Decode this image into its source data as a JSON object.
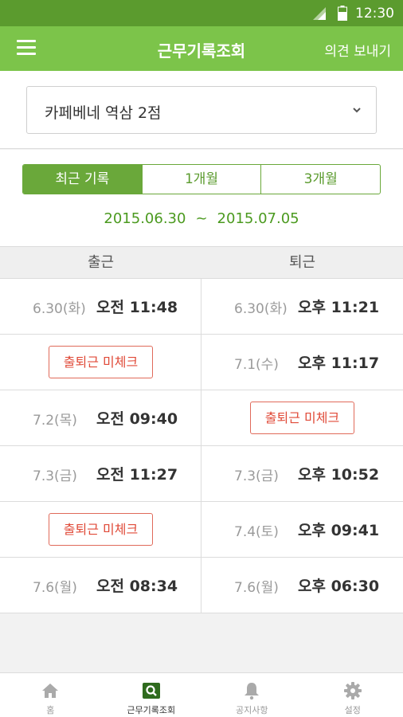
{
  "status_bar": {
    "time": "12:30"
  },
  "header": {
    "title": "근무기록조회",
    "feedback_label": "의견 보내기"
  },
  "store_select": {
    "value": "카페베네 역삼 2점"
  },
  "period_tabs": [
    {
      "label": "최근 기록",
      "active": true
    },
    {
      "label": "1개월",
      "active": false
    },
    {
      "label": "3개월",
      "active": false
    }
  ],
  "date_range": {
    "start": "2015.06.30",
    "separator": "~",
    "end": "2015.07.05"
  },
  "columns": {
    "clock_in": "출근",
    "clock_out": "퇴근"
  },
  "records": [
    {
      "in": {
        "date": "6.30(화)",
        "time": "오전 11:48"
      },
      "out": {
        "date": "6.30(화)",
        "time": "오후 11:21"
      }
    },
    {
      "in": {
        "missing": "출퇴근 미체크"
      },
      "out": {
        "date": "7.1(수)",
        "time": "오후 11:17"
      }
    },
    {
      "in": {
        "date": "7.2(목)",
        "time": "오전 09:40"
      },
      "out": {
        "missing": "출퇴근 미체크"
      }
    },
    {
      "in": {
        "date": "7.3(금)",
        "time": "오전 11:27"
      },
      "out": {
        "date": "7.3(금)",
        "time": "오후 10:52"
      }
    },
    {
      "in": {
        "missing": "출퇴근 미체크"
      },
      "out": {
        "date": "7.4(토)",
        "time": "오후 09:41"
      }
    },
    {
      "in": {
        "date": "7.6(월)",
        "time": "오전 08:34"
      },
      "out": {
        "date": "7.6(월)",
        "time": "오후 06:30"
      }
    }
  ],
  "bottom_nav": [
    {
      "label": "홈",
      "icon": "home-icon",
      "active": false
    },
    {
      "label": "근무기록조회",
      "icon": "search-icon",
      "active": true
    },
    {
      "label": "공지사항",
      "icon": "bell-icon",
      "active": false
    },
    {
      "label": "설정",
      "icon": "gear-icon",
      "active": false
    }
  ],
  "colors": {
    "status_bar": "#5b9b2e",
    "app_bar": "#7cc44a",
    "accent": "#6aa83a",
    "warning": "#e04a38"
  }
}
